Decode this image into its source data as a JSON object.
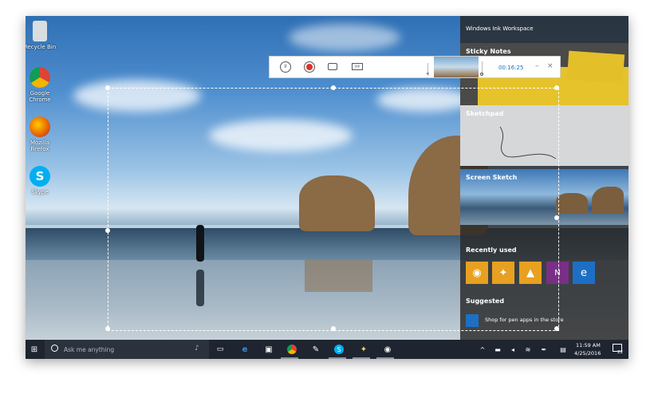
{
  "desktop": {
    "icons": [
      {
        "label": "Recycle Bin"
      },
      {
        "label": "Google Chrome"
      },
      {
        "label": "Mozilla Firefox"
      },
      {
        "label": "Skype"
      }
    ]
  },
  "recorder": {
    "time": "00:16:25",
    "icons": [
      "pause-icon",
      "record-icon",
      "camera-icon",
      "pip-icon",
      "microphone-icon",
      "minimize-icon",
      "close-icon"
    ]
  },
  "ink_workspace": {
    "title": "Windows Ink Workspace",
    "sticky_notes": "Sticky Notes",
    "sketchpad": "Sketchpad",
    "screen_sketch": "Screen Sketch",
    "recently_used": "Recently used",
    "suggested": "Suggested",
    "suggested_item": "Shop for pen apps in the store"
  },
  "taskbar": {
    "search_placeholder": "Ask me anything",
    "time": "11:59 AM",
    "date": "4/25/2016",
    "notifications": "22"
  },
  "colors": {
    "accent_orange": "#e8a020",
    "onenote_purple": "#7a2f86",
    "edge_blue": "#1d6fc4",
    "sticky_yellow": "#e6c32a",
    "taskbar": "#1e2530"
  }
}
